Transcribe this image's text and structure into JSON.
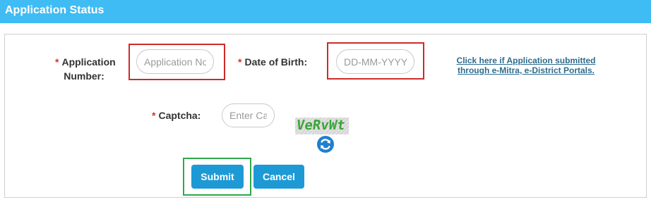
{
  "header": {
    "title": "Application Status"
  },
  "form": {
    "required_mark": "*",
    "application_number": {
      "label": "Application Number:",
      "placeholder": "Application No"
    },
    "date_of_birth": {
      "label": "Date of Birth:",
      "placeholder": "DD-MM-YYYY"
    },
    "captcha": {
      "label": "Captcha:",
      "placeholder": "Enter Captcha",
      "image_text": "VeRvWt"
    },
    "emitra_link": {
      "line1": "Click here if Application submitted",
      "line2": "through e-Mitra, e-District Portals."
    },
    "buttons": {
      "submit": "Submit",
      "cancel": "Cancel"
    }
  },
  "colors": {
    "header_bg": "#3fbcf3",
    "button_bg": "#1d9ad6",
    "required": "#d9302c",
    "highlight_red": "#cc2b2b",
    "highlight_green": "#2ea84a",
    "link": "#2e6c8e"
  },
  "icons": {
    "refresh": "refresh-icon"
  }
}
